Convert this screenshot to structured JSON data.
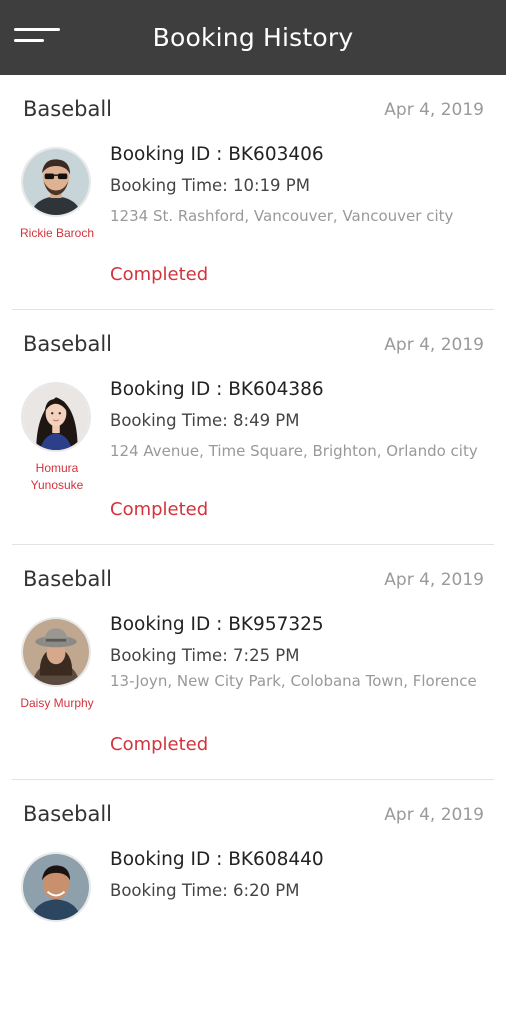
{
  "header": {
    "title": "Booking History"
  },
  "bookings": [
    {
      "sport": "Baseball",
      "date": "Apr 4, 2019",
      "person": "Rickie Baroch",
      "booking_id": "Booking ID : BK603406",
      "booking_time": "Booking Time: 10:19 PM",
      "address": "1234 St. Rashford, Vancouver, Vancouver city",
      "status": "Completed"
    },
    {
      "sport": "Baseball",
      "date": "Apr 4, 2019",
      "person": "Homura Yunosuke",
      "booking_id": "Booking ID : BK604386",
      "booking_time": "Booking Time: 8:49 PM",
      "address": "124 Avenue, Time Square, Brighton, Orlando city",
      "status": "Completed"
    },
    {
      "sport": "Baseball",
      "date": "Apr 4, 2019",
      "person": "Daisy Murphy",
      "booking_id": "Booking ID : BK957325",
      "booking_time": "Booking Time: 7:25 PM",
      "address": "13-Joyn, New City Park, Colobana Town, Florence",
      "status": "Completed"
    },
    {
      "sport": "Baseball",
      "date": "Apr 4, 2019",
      "booking_id": "Booking ID : BK608440",
      "booking_time": "Booking Time: 6:20 PM"
    }
  ],
  "colors": {
    "appbar": "#3f3e3e",
    "accent": "#d2343d",
    "muted": "#9a9a9a"
  },
  "icons": {
    "menu": "hamburger-menu-icon"
  }
}
